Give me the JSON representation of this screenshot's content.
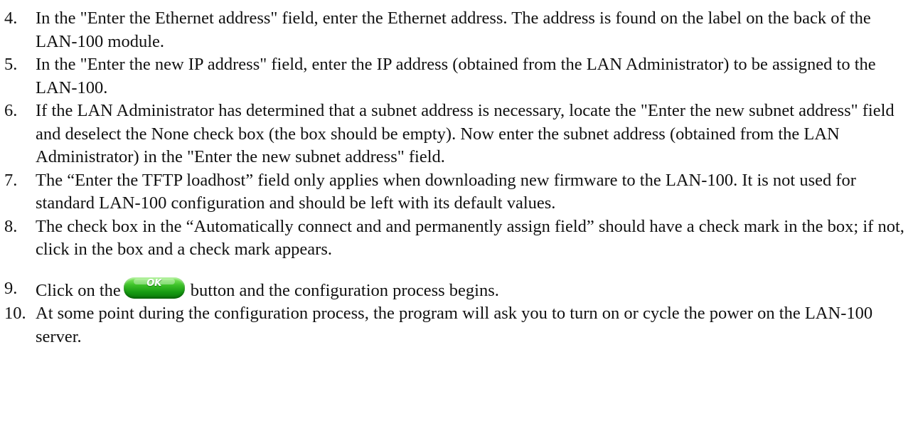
{
  "steps": [
    {
      "number": "4.",
      "text": "In the \"Enter the Ethernet address\" field, enter the Ethernet address. The address is found on the label on the back of the LAN-100 module."
    },
    {
      "number": "5.",
      "text": "In the \"Enter the new IP address\" field, enter the IP address (obtained from the LAN Administrator) to be assigned to the LAN-100."
    },
    {
      "number": "6.",
      "text": "If the LAN Administrator has determined that a subnet address is necessary, locate the \"Enter the new subnet address\" field and deselect the None check box (the box should be empty). Now enter the subnet address (obtained from the LAN Administrator) in the \"Enter the new subnet address\" field."
    },
    {
      "number": "7.",
      "text": "The “Enter the TFTP loadhost” field only applies when downloading new firmware to the LAN-100. It is not used for standard LAN-100 configuration and should be left with its default values."
    },
    {
      "number": "8.",
      "text": "The check box in the “Automatically connect and and permanently assign field” should have a check mark in the box; if not, click in the box and a check mark appears."
    },
    {
      "number": "9.",
      "text_before": "Click on the",
      "button_label": "OK",
      "text_after": "button and the configuration process begins."
    },
    {
      "number": "10.",
      "text": "At some point during the configuration process, the program will ask you to turn on or cycle the power on the LAN-100 server."
    }
  ],
  "colors": {
    "text": "#111111",
    "ok_button": "#1fa81a"
  },
  "icons": {
    "ok_button": "green-oval-ok-button"
  }
}
